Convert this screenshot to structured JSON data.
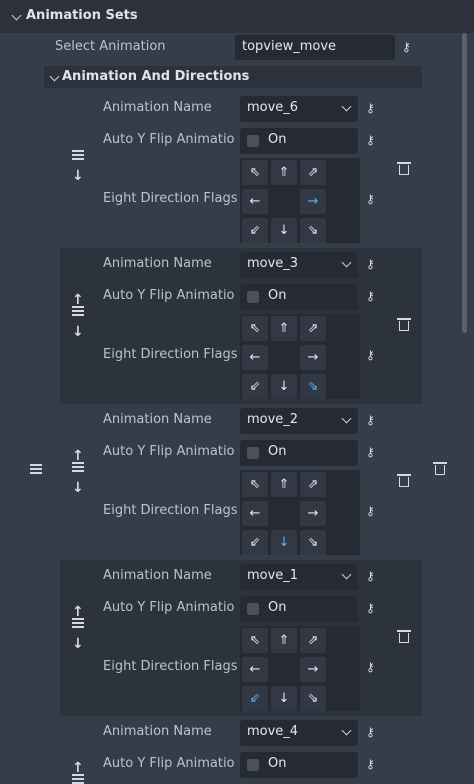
{
  "section": {
    "title": "Animation Sets"
  },
  "select_animation": {
    "label": "Select Animation",
    "value": "topview_move"
  },
  "subsection": {
    "title": "Animation And Directions"
  },
  "entries": [
    {
      "name_label": "Animation Name",
      "name_value": "move_6",
      "flip_label": "Auto Y Flip Animatio",
      "flip_value": "On",
      "flags_label": "Eight Direction Flags",
      "active_direction": "right"
    },
    {
      "name_label": "Animation Name",
      "name_value": "move_3",
      "flip_label": "Auto Y Flip Animatio",
      "flip_value": "On",
      "flags_label": "Eight Direction Flags",
      "active_direction": "down-right"
    },
    {
      "name_label": "Animation Name",
      "name_value": "move_2",
      "flip_label": "Auto Y Flip Animatio",
      "flip_value": "On",
      "flags_label": "Eight Direction Flags",
      "active_direction": "down"
    },
    {
      "name_label": "Animation Name",
      "name_value": "move_1",
      "flip_label": "Auto Y Flip Animatio",
      "flip_value": "On",
      "flags_label": "Eight Direction Flags",
      "active_direction": "down-left"
    },
    {
      "name_label": "Animation Name",
      "name_value": "move_4",
      "flip_label": "Auto Y Flip Animatio",
      "flip_value": "On"
    }
  ],
  "direction_glyphs": {
    "up-left": "⇖",
    "up": "⇑",
    "up-right": "⇗",
    "left": "←",
    "right": "→",
    "down-left": "⇙",
    "down": "↓",
    "down-right": "⇘"
  },
  "icons": {
    "key": "key-icon",
    "drag": "drag-handle-icon",
    "move_up": "arrow-up-icon",
    "move_down": "arrow-down-icon",
    "delete": "trash-icon"
  },
  "colors": {
    "background": "#363d4a",
    "header": "#2c313b",
    "field": "#262b33",
    "active_arrow": "#5ab4f7"
  }
}
